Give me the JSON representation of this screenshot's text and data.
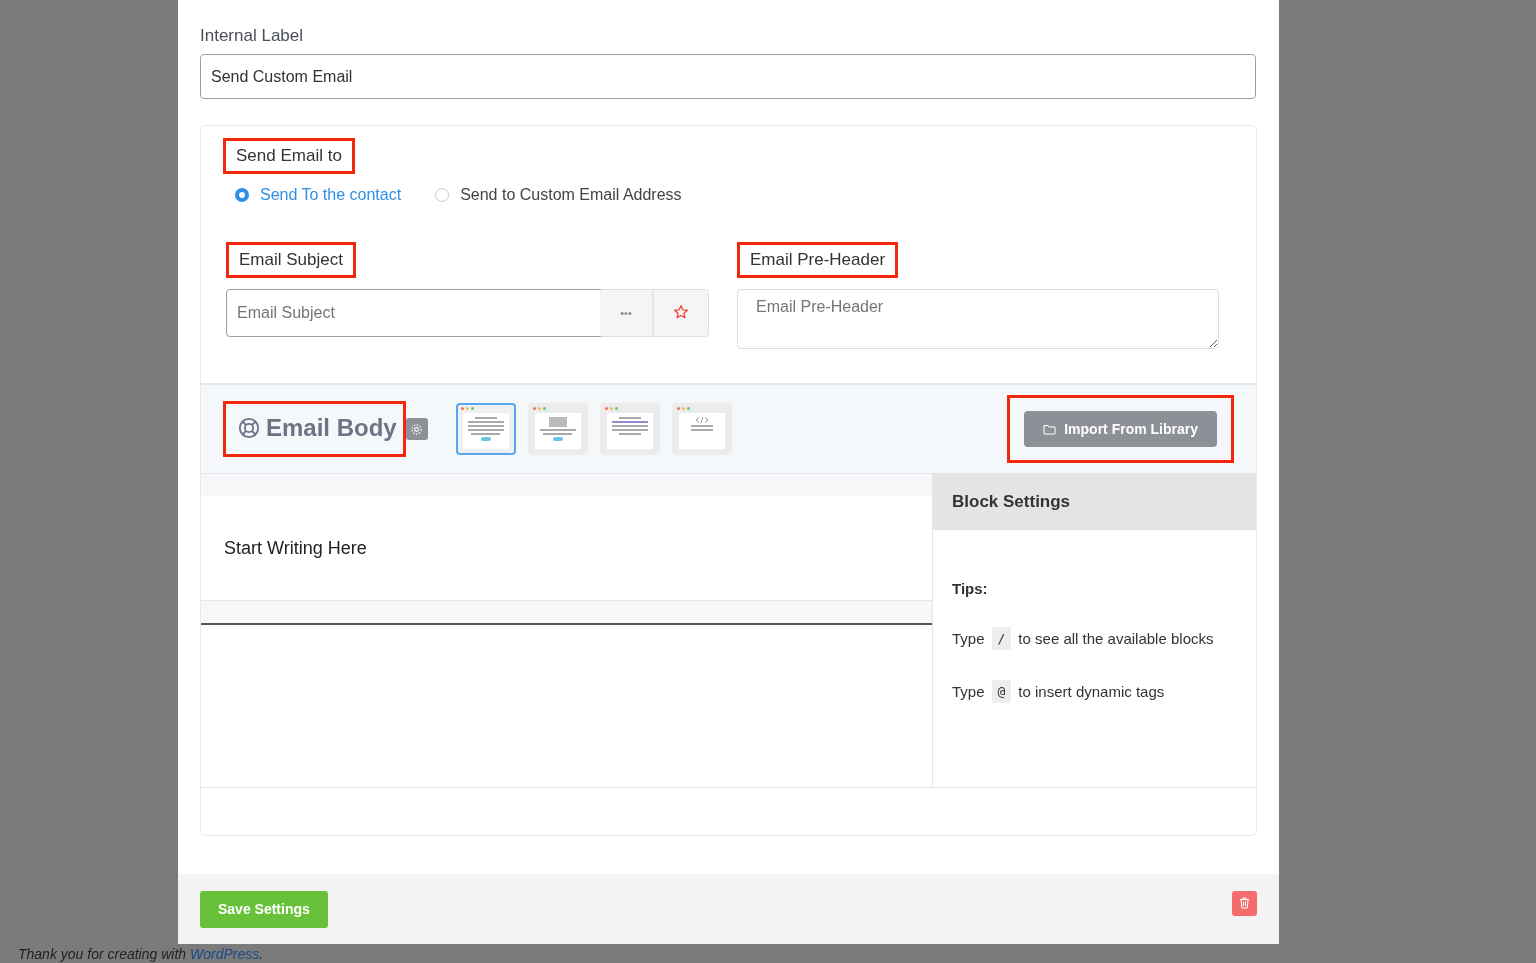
{
  "internal_label": {
    "label": "Internal Label",
    "value": "Send Custom Email"
  },
  "send_email_to": {
    "label": "Send Email to",
    "options": [
      {
        "label": "Send To the contact",
        "selected": true
      },
      {
        "label": "Send to Custom Email Address",
        "selected": false
      }
    ]
  },
  "email_subject": {
    "label": "Email Subject",
    "placeholder": "Email Subject",
    "more": "•••"
  },
  "email_preheader": {
    "label": "Email Pre-Header",
    "placeholder": "Email Pre-Header"
  },
  "email_body": {
    "title": "Email Body",
    "templates": [
      {
        "kind": "text",
        "selected": true
      },
      {
        "kind": "image",
        "selected": false
      },
      {
        "kind": "article",
        "selected": false
      },
      {
        "kind": "code",
        "selected": false
      }
    ],
    "import_button": "Import From Library"
  },
  "editor": {
    "placeholder": "Start Writing Here"
  },
  "block_settings": {
    "title": "Block Settings",
    "tips_title": "Tips:",
    "tips": [
      {
        "before": "Type",
        "key": "/",
        "after": "to see all the available blocks"
      },
      {
        "before": "Type",
        "key": "@",
        "after": "to insert dynamic tags"
      }
    ]
  },
  "save_button": "Save Settings",
  "footer_text": {
    "before": "Thank you for creating with",
    "link": "WordPress",
    "after": "."
  }
}
